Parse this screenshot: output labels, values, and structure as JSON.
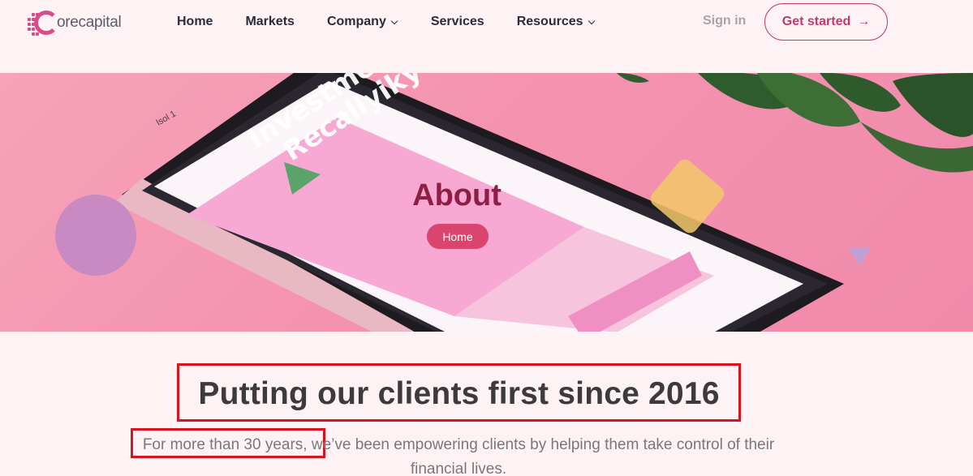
{
  "brand": {
    "name": "orecapital",
    "initial": "C",
    "accent": "#d94c8a"
  },
  "nav": {
    "items": [
      {
        "label": "Home",
        "dropdown": false
      },
      {
        "label": "Markets",
        "dropdown": false
      },
      {
        "label": "Company",
        "dropdown": true
      },
      {
        "label": "Services",
        "dropdown": false
      },
      {
        "label": "Resources",
        "dropdown": true
      }
    ],
    "signin_label": "Sign in",
    "cta_label": "Get started",
    "cta_icon": "arrow-right-icon"
  },
  "hero": {
    "title": "About",
    "breadcrumb_label": "Home",
    "phone_text_1": "Investment",
    "phone_text_2": "Recallyiky",
    "phone_status": "lsol 1",
    "title_color": "#8e1f44",
    "pill_color": "#d9456f"
  },
  "content": {
    "headline_main": "Putting our clients first ",
    "headline_highlight": "since 2016",
    "subtext_highlight": "For more than 30 years,",
    "subtext_rest": " we’ve been empowering clients by helping them take control of their financial lives."
  },
  "colors": {
    "annotation_red": "#d8141f",
    "highlight": "#f6e2a8"
  }
}
